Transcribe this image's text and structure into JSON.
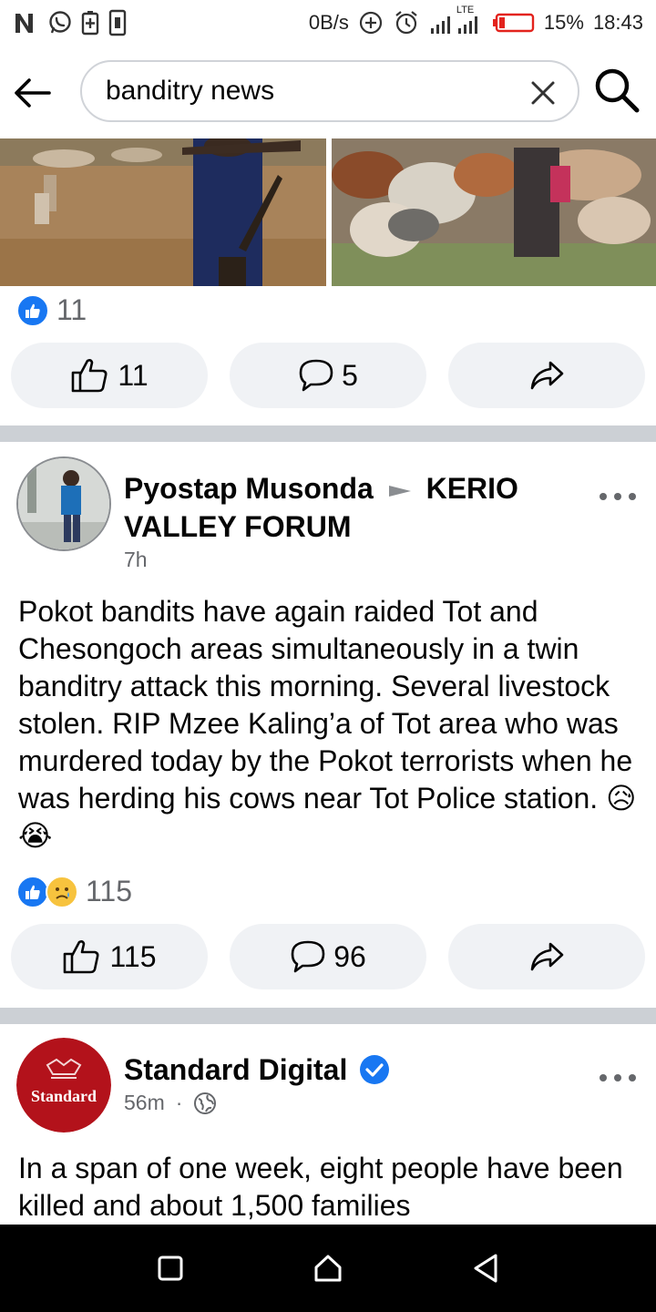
{
  "status_bar": {
    "speed": "0B/s",
    "lte": "LTE",
    "battery": "15%",
    "time": "18:43"
  },
  "search": {
    "query": "banditry news",
    "placeholder": "Search"
  },
  "post1": {
    "reaction_count": "11",
    "like_count": "11",
    "comment_count": "5"
  },
  "post2": {
    "author": "Pyostap Musonda",
    "group": "KERIO VALLEY FORUM",
    "time": "7h",
    "text": "Pokot bandits have again raided Tot and Chesongoch areas simultaneously in a twin banditry attack this morning. Several livestock stolen. RIP Mzee Kaling’a of Tot area who was murdered today by the Pokot terrorists when he was herding his cows near Tot Police station.",
    "emojis": "😥 😭",
    "reaction_count": "115",
    "like_count": "115",
    "comment_count": "96"
  },
  "post3": {
    "author": "Standard Digital",
    "logo_text": "Standard",
    "time": "56m",
    "separator": "·",
    "text": "In a span of one week, eight people have been killed and about 1,500 families"
  },
  "colors": {
    "facebook_blue": "#1877f2",
    "button_bg": "#f0f2f5",
    "divider": "#ccd0d5",
    "standard_red": "#b3121b"
  }
}
